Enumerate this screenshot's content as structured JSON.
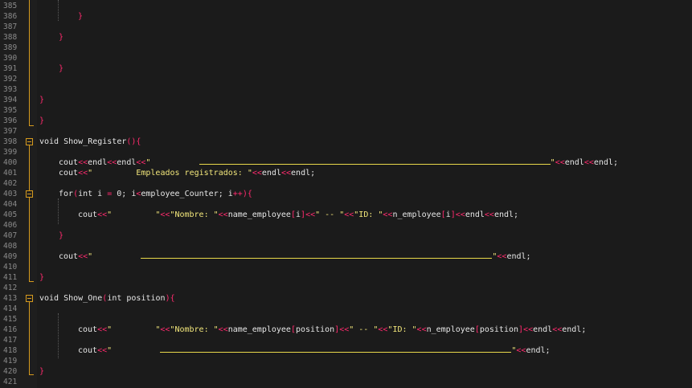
{
  "editor": {
    "lines": [
      {
        "n": "385",
        "parts": []
      },
      {
        "n": "386",
        "indent": 4,
        "parts": [
          {
            "c": "brace",
            "t": "}"
          }
        ]
      },
      {
        "n": "387",
        "parts": []
      },
      {
        "n": "388",
        "indent": 2,
        "parts": [
          {
            "c": "brace",
            "t": "}"
          }
        ]
      },
      {
        "n": "389",
        "parts": []
      },
      {
        "n": "390",
        "parts": []
      },
      {
        "n": "391",
        "indent": 2,
        "parts": [
          {
            "c": "brace",
            "t": "}"
          }
        ]
      },
      {
        "n": "392",
        "parts": []
      },
      {
        "n": "393",
        "parts": []
      },
      {
        "n": "394",
        "indent": 0,
        "parts": [
          {
            "c": "brace",
            "t": "}"
          }
        ]
      },
      {
        "n": "395",
        "parts": []
      },
      {
        "n": "396",
        "indent": 0,
        "parts": [
          {
            "c": "brace",
            "t": "}"
          }
        ]
      },
      {
        "n": "397",
        "parts": []
      },
      {
        "n": "398",
        "indent": 0,
        "parts": [
          {
            "c": "kw",
            "t": "void Show_Register"
          },
          {
            "c": "brace",
            "t": "(){"
          }
        ]
      },
      {
        "n": "399",
        "parts": []
      },
      {
        "n": "400",
        "indent": 2,
        "parts": [
          {
            "c": "txt",
            "t": "cout"
          },
          {
            "c": "op",
            "t": "<<"
          },
          {
            "c": "txt",
            "t": "endl"
          },
          {
            "c": "op",
            "t": "<<"
          },
          {
            "c": "txt",
            "t": "endl"
          },
          {
            "c": "op",
            "t": "<<"
          },
          {
            "c": "str",
            "t": "\"          "
          },
          {
            "c": "uline",
            "w": 437
          },
          {
            "c": "str",
            "t": "\""
          },
          {
            "c": "op",
            "t": "<<"
          },
          {
            "c": "txt",
            "t": "endl"
          },
          {
            "c": "op",
            "t": "<<"
          },
          {
            "c": "txt",
            "t": "endl;"
          }
        ]
      },
      {
        "n": "401",
        "indent": 2,
        "parts": [
          {
            "c": "txt",
            "t": "cout"
          },
          {
            "c": "op",
            "t": "<<"
          },
          {
            "c": "str",
            "t": "\"         Empleados registrados: \""
          },
          {
            "c": "op",
            "t": "<<"
          },
          {
            "c": "txt",
            "t": "endl"
          },
          {
            "c": "op",
            "t": "<<"
          },
          {
            "c": "txt",
            "t": "endl;"
          }
        ]
      },
      {
        "n": "402",
        "parts": []
      },
      {
        "n": "403",
        "indent": 2,
        "parts": [
          {
            "c": "txt",
            "t": "for"
          },
          {
            "c": "brace",
            "t": "("
          },
          {
            "c": "txt",
            "t": "int i "
          },
          {
            "c": "op",
            "t": "="
          },
          {
            "c": "txt",
            "t": " 0; i"
          },
          {
            "c": "op",
            "t": "<"
          },
          {
            "c": "txt",
            "t": "employee_Counter; i"
          },
          {
            "c": "op",
            "t": "++"
          },
          {
            "c": "brace",
            "t": "){"
          }
        ]
      },
      {
        "n": "404",
        "parts": []
      },
      {
        "n": "405",
        "indent": 4,
        "parts": [
          {
            "c": "txt",
            "t": "cout"
          },
          {
            "c": "op",
            "t": "<<"
          },
          {
            "c": "str",
            "t": "\"         \""
          },
          {
            "c": "op",
            "t": "<<"
          },
          {
            "c": "str",
            "t": "\"Nombre: \""
          },
          {
            "c": "op",
            "t": "<<"
          },
          {
            "c": "txt",
            "t": "name_employee"
          },
          {
            "c": "brace",
            "t": "["
          },
          {
            "c": "txt",
            "t": "i"
          },
          {
            "c": "brace",
            "t": "]"
          },
          {
            "c": "op",
            "t": "<<"
          },
          {
            "c": "str",
            "t": "\" -- \""
          },
          {
            "c": "op",
            "t": "<<"
          },
          {
            "c": "str",
            "t": "\"ID: \""
          },
          {
            "c": "op",
            "t": "<<"
          },
          {
            "c": "txt",
            "t": "n_employee"
          },
          {
            "c": "brace",
            "t": "["
          },
          {
            "c": "txt",
            "t": "i"
          },
          {
            "c": "brace",
            "t": "]"
          },
          {
            "c": "op",
            "t": "<<"
          },
          {
            "c": "txt",
            "t": "endl"
          },
          {
            "c": "op",
            "t": "<<"
          },
          {
            "c": "txt",
            "t": "endl;"
          }
        ]
      },
      {
        "n": "406",
        "parts": []
      },
      {
        "n": "407",
        "indent": 2,
        "parts": [
          {
            "c": "brace",
            "t": "}"
          }
        ]
      },
      {
        "n": "408",
        "parts": []
      },
      {
        "n": "409",
        "indent": 2,
        "parts": [
          {
            "c": "txt",
            "t": "cout"
          },
          {
            "c": "op",
            "t": "<<"
          },
          {
            "c": "str",
            "t": "\"          "
          },
          {
            "c": "uline",
            "w": 437
          },
          {
            "c": "str",
            "t": "\""
          },
          {
            "c": "op",
            "t": "<<"
          },
          {
            "c": "txt",
            "t": "endl;"
          }
        ]
      },
      {
        "n": "410",
        "parts": []
      },
      {
        "n": "411",
        "indent": 0,
        "parts": [
          {
            "c": "brace",
            "t": "}"
          }
        ]
      },
      {
        "n": "412",
        "parts": []
      },
      {
        "n": "413",
        "indent": 0,
        "parts": [
          {
            "c": "kw",
            "t": "void Show_One"
          },
          {
            "c": "brace",
            "t": "("
          },
          {
            "c": "txt",
            "t": "int position"
          },
          {
            "c": "brace",
            "t": "){"
          }
        ]
      },
      {
        "n": "414",
        "parts": []
      },
      {
        "n": "415",
        "parts": []
      },
      {
        "n": "416",
        "indent": 4,
        "parts": [
          {
            "c": "txt",
            "t": "cout"
          },
          {
            "c": "op",
            "t": "<<"
          },
          {
            "c": "str",
            "t": "\"         \""
          },
          {
            "c": "op",
            "t": "<<"
          },
          {
            "c": "str",
            "t": "\"Nombre: \""
          },
          {
            "c": "op",
            "t": "<<"
          },
          {
            "c": "txt",
            "t": "name_employee"
          },
          {
            "c": "brace",
            "t": "["
          },
          {
            "c": "txt",
            "t": "position"
          },
          {
            "c": "brace",
            "t": "]"
          },
          {
            "c": "op",
            "t": "<<"
          },
          {
            "c": "str",
            "t": "\" -- \""
          },
          {
            "c": "op",
            "t": "<<"
          },
          {
            "c": "str",
            "t": "\"ID: \""
          },
          {
            "c": "op",
            "t": "<<"
          },
          {
            "c": "txt",
            "t": "n_employee"
          },
          {
            "c": "brace",
            "t": "["
          },
          {
            "c": "txt",
            "t": "position"
          },
          {
            "c": "brace",
            "t": "]"
          },
          {
            "c": "op",
            "t": "<<"
          },
          {
            "c": "txt",
            "t": "endl"
          },
          {
            "c": "op",
            "t": "<<"
          },
          {
            "c": "txt",
            "t": "endl;"
          }
        ]
      },
      {
        "n": "417",
        "parts": []
      },
      {
        "n": "418",
        "indent": 4,
        "parts": [
          {
            "c": "txt",
            "t": "cout"
          },
          {
            "c": "op",
            "t": "<<"
          },
          {
            "c": "str",
            "t": "\"          "
          },
          {
            "c": "uline",
            "w": 437
          },
          {
            "c": "str",
            "t": "\""
          },
          {
            "c": "op",
            "t": "<<"
          },
          {
            "c": "txt",
            "t": "endl;"
          }
        ]
      },
      {
        "n": "419",
        "parts": []
      },
      {
        "n": "420",
        "indent": 0,
        "parts": [
          {
            "c": "brace",
            "t": "}"
          }
        ]
      },
      {
        "n": "421",
        "parts": []
      }
    ]
  },
  "colors": {
    "background": "#1e1e1e",
    "brace": "#ff2a6d",
    "string": "#f1e57a",
    "fold_marker": "#d79b1e",
    "line_number": "#8a8a8a"
  }
}
